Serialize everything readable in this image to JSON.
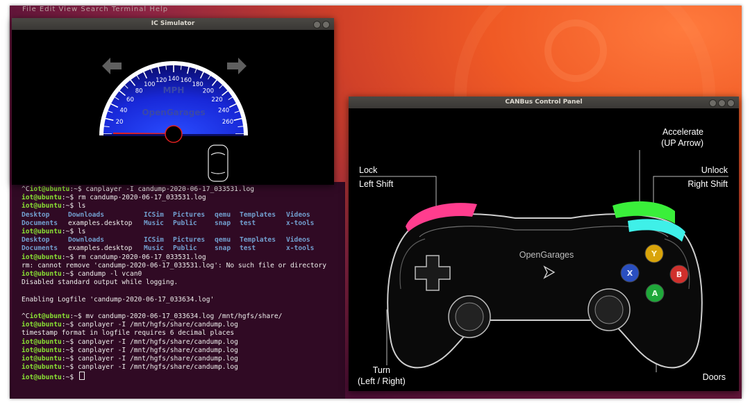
{
  "desktop": {
    "menu_text": "File  Edit  View  Search  Terminal  Help"
  },
  "ic_simulator": {
    "title": "IC Simulator",
    "speed_unit": "MPH",
    "brand": "OpenGarages",
    "speed_ticks": [
      "20",
      "40",
      "60",
      "80",
      "100",
      "120",
      "140",
      "160",
      "180",
      "200",
      "220",
      "240",
      "260"
    ],
    "speed_value": 0,
    "left_turn_signal_icon": "arrow-left-icon",
    "right_turn_signal_icon": "arrow-right-icon",
    "car_icon": "car-topdown-icon"
  },
  "terminal": {
    "prompt_user": "iot@ubuntu",
    "prompt_path": ":~$",
    "line1_prefix": "^C",
    "lines": [
      " canplayer -I candump-2020-06-17_033531.log",
      " rm candump-2020-06-17_033531.log",
      " ls"
    ],
    "ls": {
      "row1": [
        "Desktop",
        "Downloads",
        "ICSim",
        "Pictures",
        "qemu",
        "Templates",
        "Videos"
      ],
      "row2": [
        "Documents",
        "examples.desktop",
        "Music",
        "Public",
        "snap",
        "test",
        "x-tools"
      ]
    },
    "ls2_cmd": " ls",
    "rm2_cmd": " rm candump-2020-06-17_033531.log",
    "rm_error": "rm: cannot remove 'candump-2020-06-17_033531.log': No such file or directory",
    "candump_cmd": " candump -l vcan0",
    "disabled_msg": "Disabled standard output while logging.",
    "enabling_msg": "Enabling Logfile 'candump-2020-06-17_033634.log'",
    "mv_cmd": " mv candump-2020-06-17_033634.log /mnt/hgfs/share/",
    "cp1_cmd": " canplayer -I /mnt/hgfs/share/candump.log",
    "timestamp_msg": "timestamp format in logfile requires 6 decimal places",
    "cp_cmd": " canplayer -I /mnt/hgfs/share/candump.log"
  },
  "canbus": {
    "title": "CANBus Control Panel",
    "accelerate": "Accelerate",
    "accelerate_key": "(UP Arrow)",
    "lock": "Lock",
    "lock_key": "Left Shift",
    "unlock": "Unlock",
    "unlock_key": "Right Shift",
    "turn": "Turn",
    "turn_keys": "(Left / Right)",
    "doors": "Doors",
    "brand": "OpenGarages",
    "buttons": {
      "y": "Y",
      "x": "X",
      "b": "B",
      "a": "A"
    },
    "colors": {
      "y": "#d9a40a",
      "x": "#2a4fc0",
      "b": "#d0302c",
      "a": "#1fa83a",
      "lock_bumper": "#ff3d8e",
      "unlock_bumper": "#3aef3a",
      "unlock_bumper_lower": "#3ff0e8"
    }
  }
}
